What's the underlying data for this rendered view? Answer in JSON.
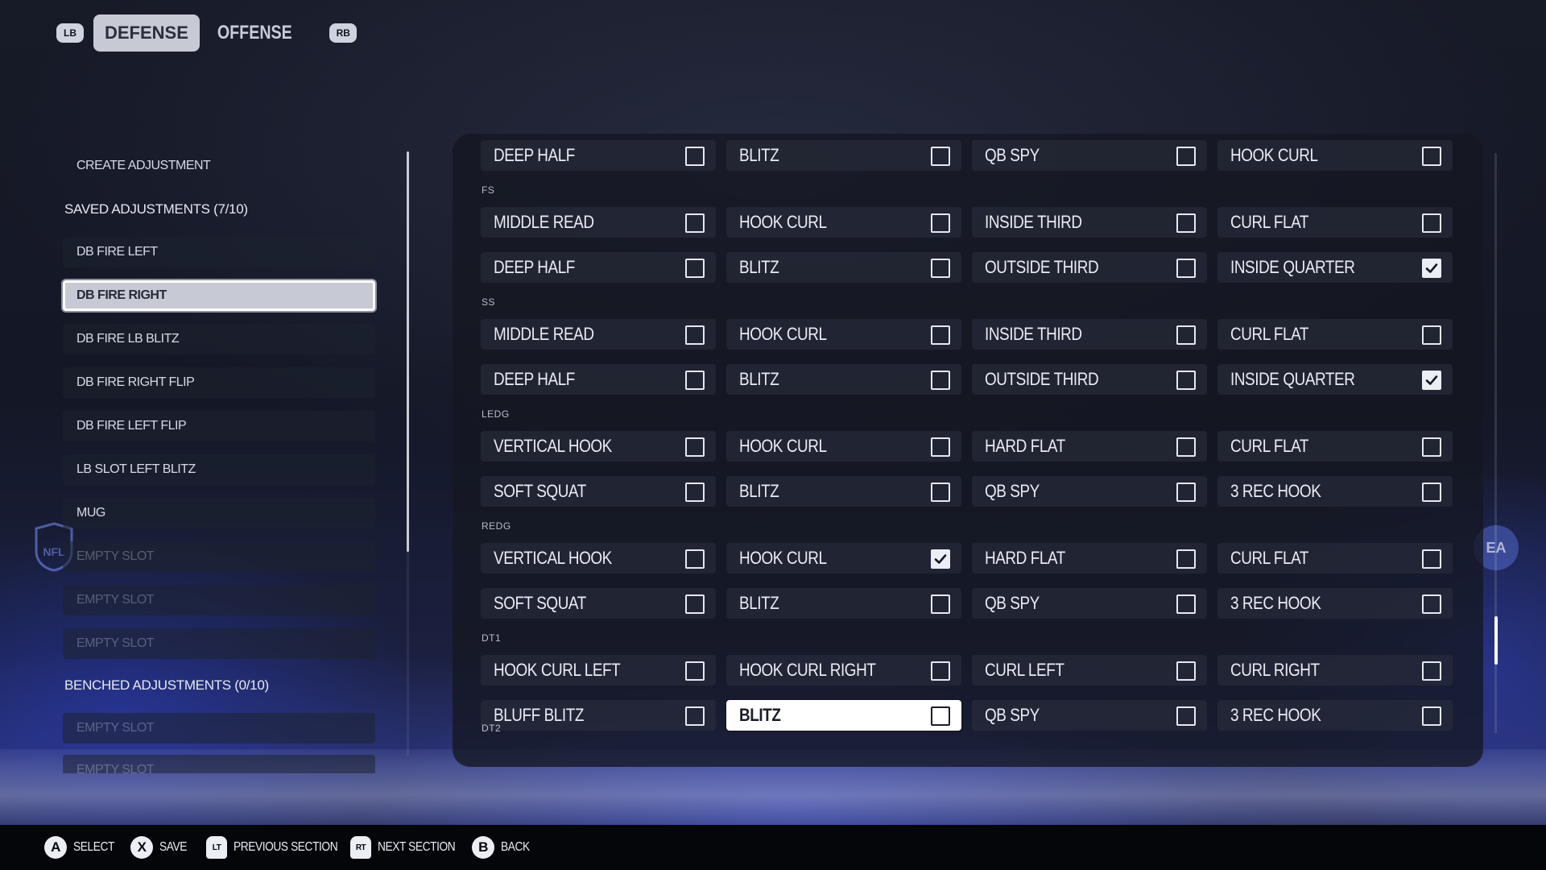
{
  "tabs": {
    "left_bumper": "LB",
    "right_bumper": "RB",
    "items": [
      {
        "label": "DEFENSE",
        "active": true
      },
      {
        "label": "OFFENSE",
        "active": false
      }
    ]
  },
  "left_panel": {
    "create": "CREATE ADJUSTMENT",
    "saved_heading": "SAVED ADJUSTMENTS (7/10)",
    "saved": [
      {
        "label": "DB FIRE LEFT"
      },
      {
        "label": "DB FIRE RIGHT",
        "selected": true
      },
      {
        "label": "DB FIRE LB BLITZ"
      },
      {
        "label": "DB FIRE RIGHT FLIP"
      },
      {
        "label": "DB FIRE LEFT FLIP"
      },
      {
        "label": "LB SLOT LEFT BLITZ"
      },
      {
        "label": "MUG"
      },
      {
        "label": "EMPTY SLOT"
      },
      {
        "label": "EMPTY SLOT"
      },
      {
        "label": "EMPTY SLOT"
      }
    ],
    "benched_heading": "BENCHED ADJUSTMENTS (0/10)",
    "benched": [
      {
        "label": "EMPTY SLOT"
      },
      {
        "label": "EMPTY SLOT"
      }
    ]
  },
  "assignments": {
    "rows": [
      {
        "group": "",
        "cells": [
          {
            "label": "DEEP HALF",
            "checked": false
          },
          {
            "label": "BLITZ",
            "checked": false
          },
          {
            "label": "QB SPY",
            "checked": false
          },
          {
            "label": "HOOK CURL",
            "checked": false
          }
        ]
      },
      {
        "group": "FS",
        "cells": [
          {
            "label": "MIDDLE READ",
            "checked": false
          },
          {
            "label": "HOOK CURL",
            "checked": false
          },
          {
            "label": "INSIDE THIRD",
            "checked": false
          },
          {
            "label": "CURL FLAT",
            "checked": false
          }
        ]
      },
      {
        "group": "",
        "cells": [
          {
            "label": "DEEP HALF",
            "checked": false
          },
          {
            "label": "BLITZ",
            "checked": false
          },
          {
            "label": "OUTSIDE THIRD",
            "checked": false
          },
          {
            "label": "INSIDE QUARTER",
            "checked": true
          }
        ]
      },
      {
        "group": "SS",
        "cells": [
          {
            "label": "MIDDLE READ",
            "checked": false
          },
          {
            "label": "HOOK CURL",
            "checked": false
          },
          {
            "label": "INSIDE THIRD",
            "checked": false
          },
          {
            "label": "CURL FLAT",
            "checked": false
          }
        ]
      },
      {
        "group": "",
        "cells": [
          {
            "label": "DEEP HALF",
            "checked": false
          },
          {
            "label": "BLITZ",
            "checked": false
          },
          {
            "label": "OUTSIDE THIRD",
            "checked": false
          },
          {
            "label": "INSIDE QUARTER",
            "checked": true
          }
        ]
      },
      {
        "group": "LEDG",
        "cells": [
          {
            "label": "VERTICAL HOOK",
            "checked": false
          },
          {
            "label": "HOOK CURL",
            "checked": false
          },
          {
            "label": "HARD FLAT",
            "checked": false
          },
          {
            "label": "CURL FLAT",
            "checked": false
          }
        ]
      },
      {
        "group": "",
        "cells": [
          {
            "label": "SOFT SQUAT",
            "checked": false
          },
          {
            "label": "BLITZ",
            "checked": false
          },
          {
            "label": "QB SPY",
            "checked": false
          },
          {
            "label": "3 REC HOOK",
            "checked": false
          }
        ]
      },
      {
        "group": "REDG",
        "cells": [
          {
            "label": "VERTICAL HOOK",
            "checked": false
          },
          {
            "label": "HOOK CURL",
            "checked": true
          },
          {
            "label": "HARD FLAT",
            "checked": false
          },
          {
            "label": "CURL FLAT",
            "checked": false
          }
        ]
      },
      {
        "group": "",
        "cells": [
          {
            "label": "SOFT SQUAT",
            "checked": false
          },
          {
            "label": "BLITZ",
            "checked": false
          },
          {
            "label": "QB SPY",
            "checked": false
          },
          {
            "label": "3 REC HOOK",
            "checked": false
          }
        ]
      },
      {
        "group": "DT1",
        "cells": [
          {
            "label": "HOOK CURL LEFT",
            "checked": false
          },
          {
            "label": "HOOK CURL RIGHT",
            "checked": false
          },
          {
            "label": "CURL LEFT",
            "checked": false
          },
          {
            "label": "CURL RIGHT",
            "checked": false
          }
        ]
      },
      {
        "group": "",
        "cells": [
          {
            "label": "BLUFF BLITZ",
            "checked": false
          },
          {
            "label": "BLITZ",
            "checked": false,
            "highlighted": true
          },
          {
            "label": "QB SPY",
            "checked": false
          },
          {
            "label": "3 REC HOOK",
            "checked": false
          }
        ]
      }
    ],
    "trailing_group": "DT2"
  },
  "logos": {
    "nfl": "NFL",
    "ea": "EA"
  },
  "controls": [
    {
      "button": "A",
      "kind": "circle",
      "label": "SELECT"
    },
    {
      "button": "X",
      "kind": "circle",
      "label": "SAVE"
    },
    {
      "button": "LT",
      "kind": "trigger",
      "label": "PREVIOUS SECTION"
    },
    {
      "button": "RT",
      "kind": "trigger",
      "label": "NEXT SECTION"
    },
    {
      "button": "B",
      "kind": "circle",
      "label": "BACK"
    }
  ],
  "colors": {
    "highlight": "#ffffff",
    "selected_bg": "#c7cad4",
    "panel_bg": "#14171f",
    "accent_glow": "#3c4fd6"
  }
}
